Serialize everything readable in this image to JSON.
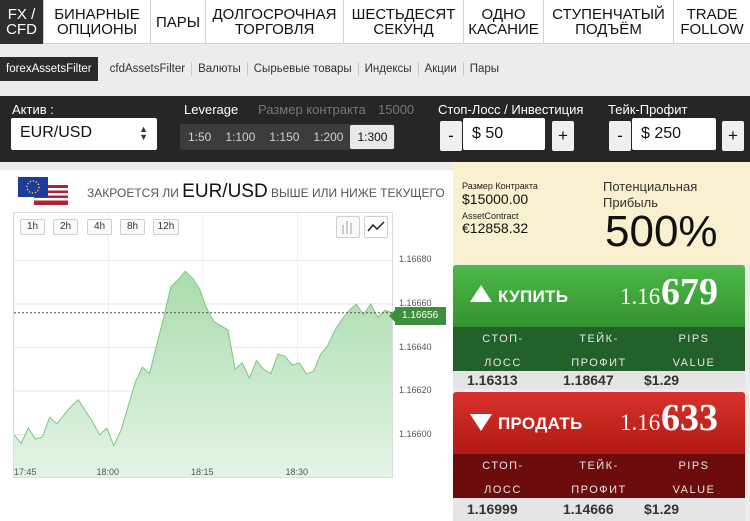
{
  "top_nav": [
    {
      "label": "FX /\nCFD"
    },
    {
      "label": "БИНАРНЫЕ\nОПЦИОНЫ"
    },
    {
      "label": "ПАРЫ"
    },
    {
      "label": "ДОЛГОСРОЧНАЯ\nТОРГОВЛЯ"
    },
    {
      "label": "ШЕСТЬДЕСЯТ\nСЕКУНД"
    },
    {
      "label": "ОДНО\nКАСАНИЕ"
    },
    {
      "label": "СТУПЕНЧАТЫЙ\nПОДЪЁМ"
    },
    {
      "label": "TRADE\nFOLLOW"
    }
  ],
  "sub_nav": [
    "forexAssetsFilter",
    "cfdAssetsFilter",
    "Валюты",
    "Сырьевые товары",
    "Индексы",
    "Акции",
    "Пары"
  ],
  "controls": {
    "asset_label": "Актив :",
    "asset_value": "EUR/USD",
    "leverage_label": "Leverage",
    "contract_size_label": "Размер контракта",
    "contract_size_value": "15000",
    "leverage_options": [
      "1:50",
      "1:100",
      "1:150",
      "1:200",
      "1:300"
    ],
    "leverage_selected": "1:300",
    "stop_loss_label": "Стоп-Лосс / Инвестиция",
    "stop_loss_value": "$ 50",
    "take_profit_label": "Тейк-Профит",
    "take_profit_value": "$ 250",
    "minus": "-",
    "plus": "+"
  },
  "question": {
    "prefix": "закроется ли",
    "pair": "EUR/USD",
    "suffix": "выше или ниже текущего"
  },
  "timeframes": [
    "1h",
    "2h",
    "4h",
    "8h",
    "12h"
  ],
  "info": {
    "contract_size_label": "Размер Контракта",
    "contract_size_value": "$15000.00",
    "asset_contract_label": "AssetContract",
    "asset_contract_value": "€12858.32",
    "potential_profit_label": "Потенциальная\nПрибыль",
    "potential_profit_value": "500%"
  },
  "buy": {
    "label": "КУПИТЬ",
    "price_prefix": "1.16",
    "price_big": "679",
    "headers": [
      "СТОП-\nЛОСС",
      "ТЕЙК-\nПРОФИТ",
      "PIPS\nVALUE"
    ],
    "values": [
      "1.16313",
      "1.18647",
      "$1.29"
    ]
  },
  "sell": {
    "label": "ПРОДАТЬ",
    "price_prefix": "1.16",
    "price_big": "633",
    "headers": [
      "СТОП-\nЛОСС",
      "ТЕЙК-\nПРОФИТ",
      "PIPS\nVALUE"
    ],
    "values": [
      "1.16999",
      "1.14666",
      "$1.29"
    ]
  },
  "colors": {
    "buy": "#3ea63a",
    "sell": "#c4211b",
    "chart_fill": "#a9dcad",
    "chart_line": "#7cc583",
    "current_price": "#3d8f3d"
  },
  "chart_data": {
    "type": "area",
    "current_value_label": "1.16656",
    "current_value": 1.16656,
    "y_ticks": [
      "1.16680",
      "1.16660",
      "1.16640",
      "1.16620",
      "1.16600"
    ],
    "x_ticks": [
      "17:45",
      "18:00",
      "18:15",
      "18:30"
    ],
    "ylim": [
      1.16587,
      1.16688
    ],
    "xlim": [
      0,
      54
    ],
    "x_tick_positions": [
      0,
      13.5,
      27,
      40.5
    ],
    "values": [
      1.166,
      1.16596,
      1.16603,
      1.16598,
      1.16599,
      1.16608,
      1.16605,
      1.16609,
      1.16613,
      1.16616,
      1.16611,
      1.16606,
      1.166,
      1.16603,
      1.16595,
      1.16602,
      1.16613,
      1.16624,
      1.16631,
      1.16628,
      1.16641,
      1.16654,
      1.16668,
      1.16671,
      1.16675,
      1.16672,
      1.16667,
      1.16658,
      1.16652,
      1.1665,
      1.16648,
      1.1663,
      1.16633,
      1.16626,
      1.16634,
      1.1663,
      1.16628,
      1.16637,
      1.16636,
      1.16632,
      1.16633,
      1.16628,
      1.16629,
      1.16637,
      1.16641,
      1.16648,
      1.16653,
      1.16657,
      1.1666,
      1.16655,
      1.1666,
      1.16654,
      1.16657,
      1.16656
    ]
  }
}
